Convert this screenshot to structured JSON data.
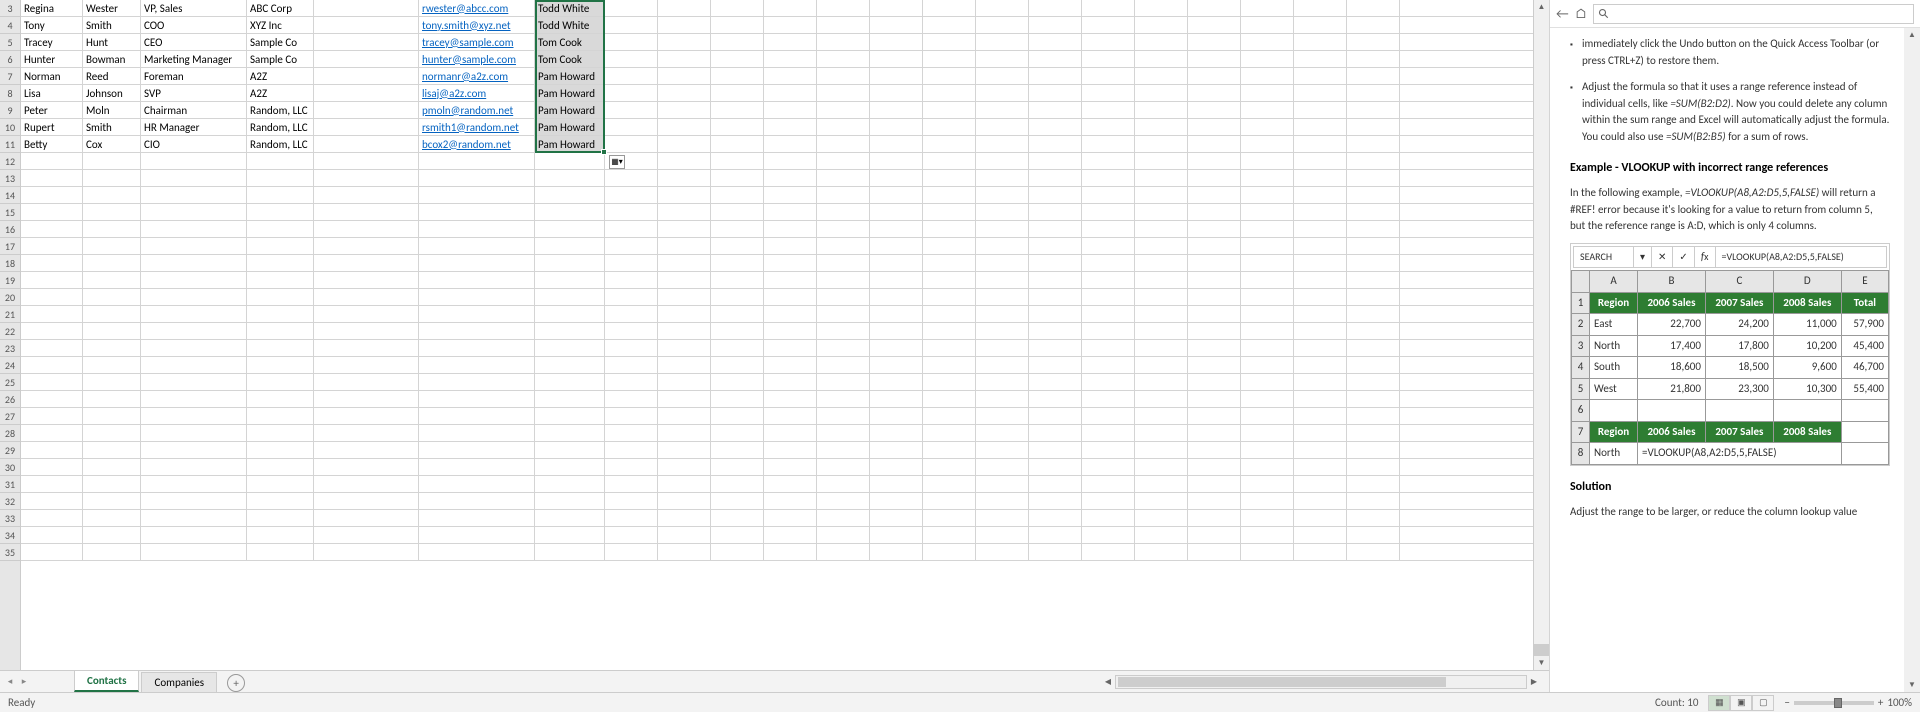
{
  "rows": [
    {
      "n": 3,
      "a": "Regina",
      "b": "Wester",
      "c": "VP, Sales",
      "d": "ABC Corp",
      "f": "rwester@abcc.com",
      "g": "Todd White"
    },
    {
      "n": 4,
      "a": "Tony",
      "b": "Smith",
      "c": "COO",
      "d": "XYZ Inc",
      "f": "tony.smith@xyz.net",
      "g": "Todd White"
    },
    {
      "n": 5,
      "a": "Tracey",
      "b": "Hunt",
      "c": "CEO",
      "d": "Sample Co",
      "f": "tracey@sample.com",
      "g": "Tom Cook"
    },
    {
      "n": 6,
      "a": "Hunter",
      "b": "Bowman",
      "c": "Marketing Manager",
      "d": "Sample Co",
      "f": "hunter@sample.com",
      "g": "Tom Cook"
    },
    {
      "n": 7,
      "a": "Norman",
      "b": "Reed",
      "c": "Foreman",
      "d": "A2Z",
      "f": "normanr@a2z.com",
      "g": "Pam Howard"
    },
    {
      "n": 8,
      "a": "Lisa",
      "b": "Johnson",
      "c": "SVP",
      "d": "A2Z",
      "f": "lisaj@a2z.com",
      "g": "Pam Howard"
    },
    {
      "n": 9,
      "a": "Peter",
      "b": "Moln",
      "c": "Chairman",
      "d": "Random, LLC",
      "f": "pmoln@random.net",
      "g": "Pam Howard"
    },
    {
      "n": 10,
      "a": "Rupert",
      "b": "Smith",
      "c": "HR Manager",
      "d": "Random, LLC",
      "f": "rsmith1@random.net",
      "g": "Pam Howard"
    },
    {
      "n": 11,
      "a": "Betty",
      "b": "Cox",
      "c": "CIO",
      "d": "Random, LLC",
      "f": "bcox2@random.net",
      "g": "Pam Howard"
    }
  ],
  "emptyRows": [
    12,
    13,
    14,
    15,
    16,
    17,
    18,
    19,
    20,
    21,
    22,
    23,
    24,
    25,
    26,
    27,
    28,
    29,
    30,
    31,
    32,
    33,
    34,
    35
  ],
  "tabs": {
    "active": "Contacts",
    "other": "Companies"
  },
  "status": {
    "ready": "Ready",
    "count": "Count: 10",
    "zoom": "100%"
  },
  "help": {
    "bullet1a": "immediately click the Undo button on the Quick Access Toolbar (or press CTRL+Z) to restore them.",
    "bullet2a": "Adjust the formula so that it uses a range reference instead of individual cells, like ",
    "bullet2b": "=SUM(B2:D2)",
    "bullet2c": ". Now you could delete any column within the sum range and Excel will automatically adjust the formula. You could also use ",
    "bullet2d": "=SUM(B2:B5)",
    "bullet2e": " for a sum of rows.",
    "h1": "Example - VLOOKUP with incorrect range references",
    "p1a": "In the following example, ",
    "p1b": "=VLOOKUP(A8,A2:D5,5,FALSE)",
    "p1c": " will return a #REF! error because it's looking for a value to return from column 5, but the reference range is A:D, which is only 4 columns.",
    "h2": "Solution",
    "p2": "Adjust the range to be larger, or reduce the column lookup value",
    "img": {
      "search": "SEARCH",
      "fx": "=VLOOKUP(A8,A2:D5,5,FALSE)",
      "cols": [
        "A",
        "B",
        "C",
        "D",
        "E"
      ],
      "hdr": [
        "Region",
        "2006 Sales",
        "2007 Sales",
        "2008 Sales",
        "Total"
      ],
      "r2": [
        "East",
        "22,700",
        "24,200",
        "11,000",
        "57,900"
      ],
      "r3": [
        "North",
        "17,400",
        "17,800",
        "10,200",
        "45,400"
      ],
      "r4": [
        "South",
        "18,600",
        "18,500",
        "9,600",
        "46,700"
      ],
      "r5": [
        "West",
        "21,800",
        "23,300",
        "10,300",
        "55,400"
      ],
      "hdr2": [
        "Region",
        "2006 Sales",
        "2007 Sales",
        "2008 Sales"
      ],
      "r8": [
        "North",
        "=VLOOKUP(A8,A2:D5,5,FALSE)"
      ]
    }
  }
}
